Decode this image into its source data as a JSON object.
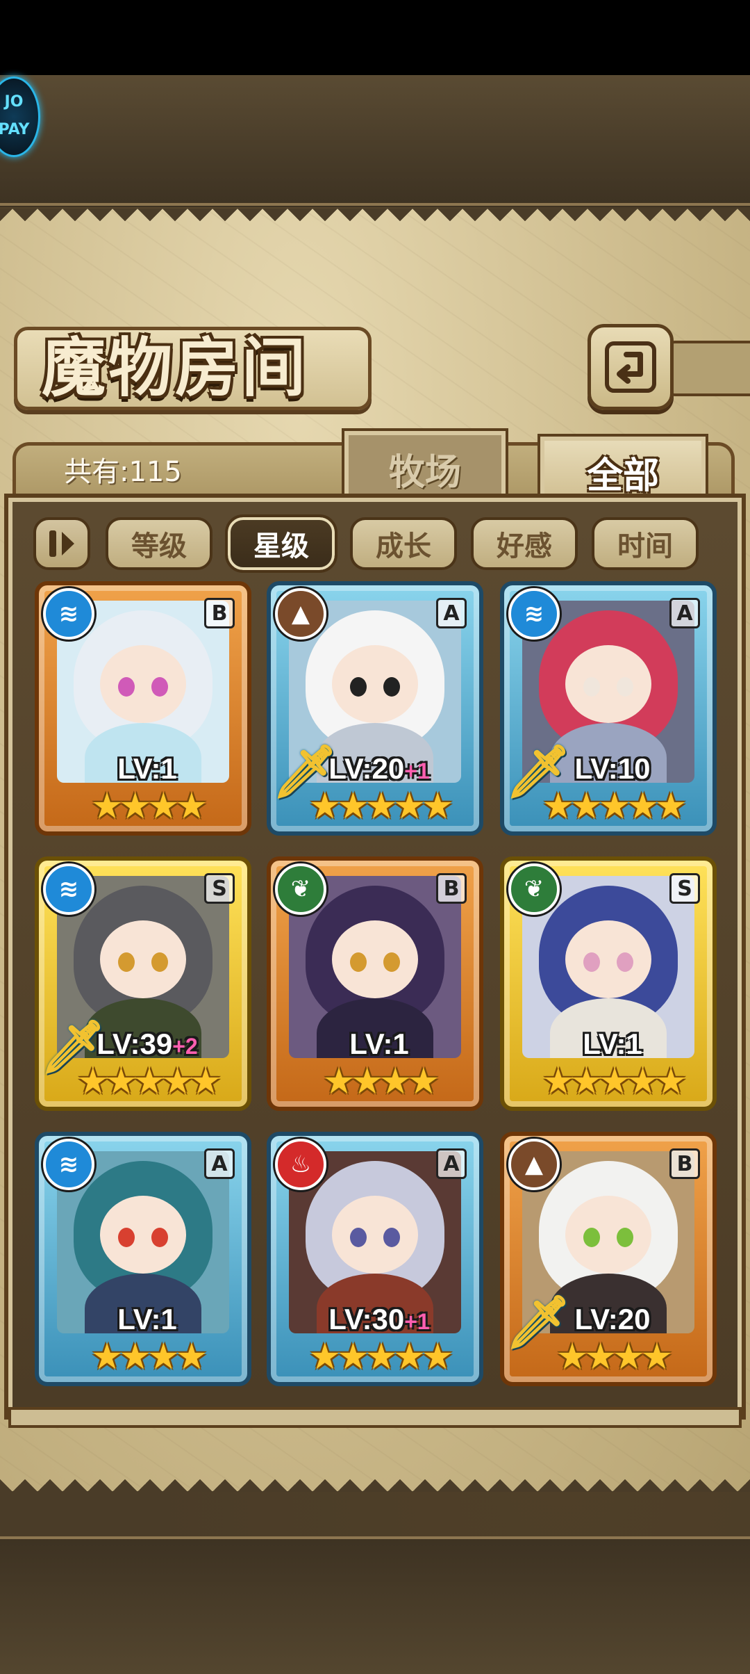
{
  "header": {
    "logo_text": "JO\nPAY",
    "title": "魔物房间"
  },
  "tabs": {
    "count_label": "共有:115",
    "ranch": "牧场",
    "all": "全部"
  },
  "sort": {
    "chips": [
      "等级",
      "星级",
      "成长",
      "好感",
      "时间"
    ],
    "active_index": 1
  },
  "colors": {
    "water": "#1f8ad8",
    "earth": "#7a4a2a",
    "nature": "#2e7d3a",
    "fire": "#d42a2a"
  },
  "cards": [
    {
      "level": "LV:1",
      "plus": "",
      "rank": "B",
      "element": "water-icon",
      "frame": "orange",
      "stars": "★★★★",
      "weapon": false,
      "hair": "#e8eef4",
      "eye": "#d05ab8",
      "outfit": "#bfe4f0",
      "bg": "#d8ecf4"
    },
    {
      "level": "LV:20",
      "plus": "+1",
      "rank": "A",
      "element": "earth-icon",
      "frame": "blue",
      "stars": "★★★★★",
      "weapon": true,
      "hair": "#f5f5f5",
      "eye": "#222222",
      "outfit": "#bfc8d4",
      "bg": "#a7c9dc"
    },
    {
      "level": "LV:10",
      "plus": "",
      "rank": "A",
      "element": "water-icon",
      "frame": "blue",
      "stars": "★★★★★",
      "weapon": true,
      "hair": "#d23c5a",
      "eye": "#f0e6dc",
      "outfit": "#9aa4c0",
      "bg": "#6a6f88"
    },
    {
      "level": "LV:39",
      "plus": "+2",
      "rank": "S",
      "element": "water-icon",
      "frame": "gold",
      "stars": "★★★★★",
      "weapon": true,
      "hair": "#5a5a5e",
      "eye": "#d49a30",
      "outfit": "#3e4a2e",
      "bg": "#7b7a70"
    },
    {
      "level": "LV:1",
      "plus": "",
      "rank": "B",
      "element": "nature-icon",
      "frame": "orange",
      "stars": "★★★★",
      "weapon": false,
      "hair": "#3b2c55",
      "eye": "#d49a30",
      "outfit": "#2c2440",
      "bg": "#6c5a80"
    },
    {
      "level": "LV:1",
      "plus": "",
      "rank": "S",
      "element": "nature-icon",
      "frame": "gold",
      "stars": "★★★★★",
      "weapon": false,
      "hair": "#3c4a9a",
      "eye": "#e0a0c0",
      "outfit": "#e8e4dc",
      "bg": "#cdd2e4"
    },
    {
      "level": "LV:1",
      "plus": "",
      "rank": "A",
      "element": "water-icon",
      "frame": "blue",
      "stars": "★★★★",
      "weapon": false,
      "hair": "#2d7a86",
      "eye": "#d84030",
      "outfit": "#334466",
      "bg": "#6aa6b8"
    },
    {
      "level": "LV:30",
      "plus": "+1",
      "rank": "A",
      "element": "fire-icon",
      "frame": "blue",
      "stars": "★★★★★",
      "weapon": false,
      "hair": "#c7c9dc",
      "eye": "#5a5aa0",
      "outfit": "#8a3a2a",
      "bg": "#5a3a34"
    },
    {
      "level": "LV:20",
      "plus": "",
      "rank": "B",
      "element": "earth-icon",
      "frame": "orange",
      "stars": "★★★★",
      "weapon": true,
      "hair": "#f2f2f0",
      "eye": "#7cbf3c",
      "outfit": "#3a3030",
      "bg": "#b89a70"
    }
  ]
}
